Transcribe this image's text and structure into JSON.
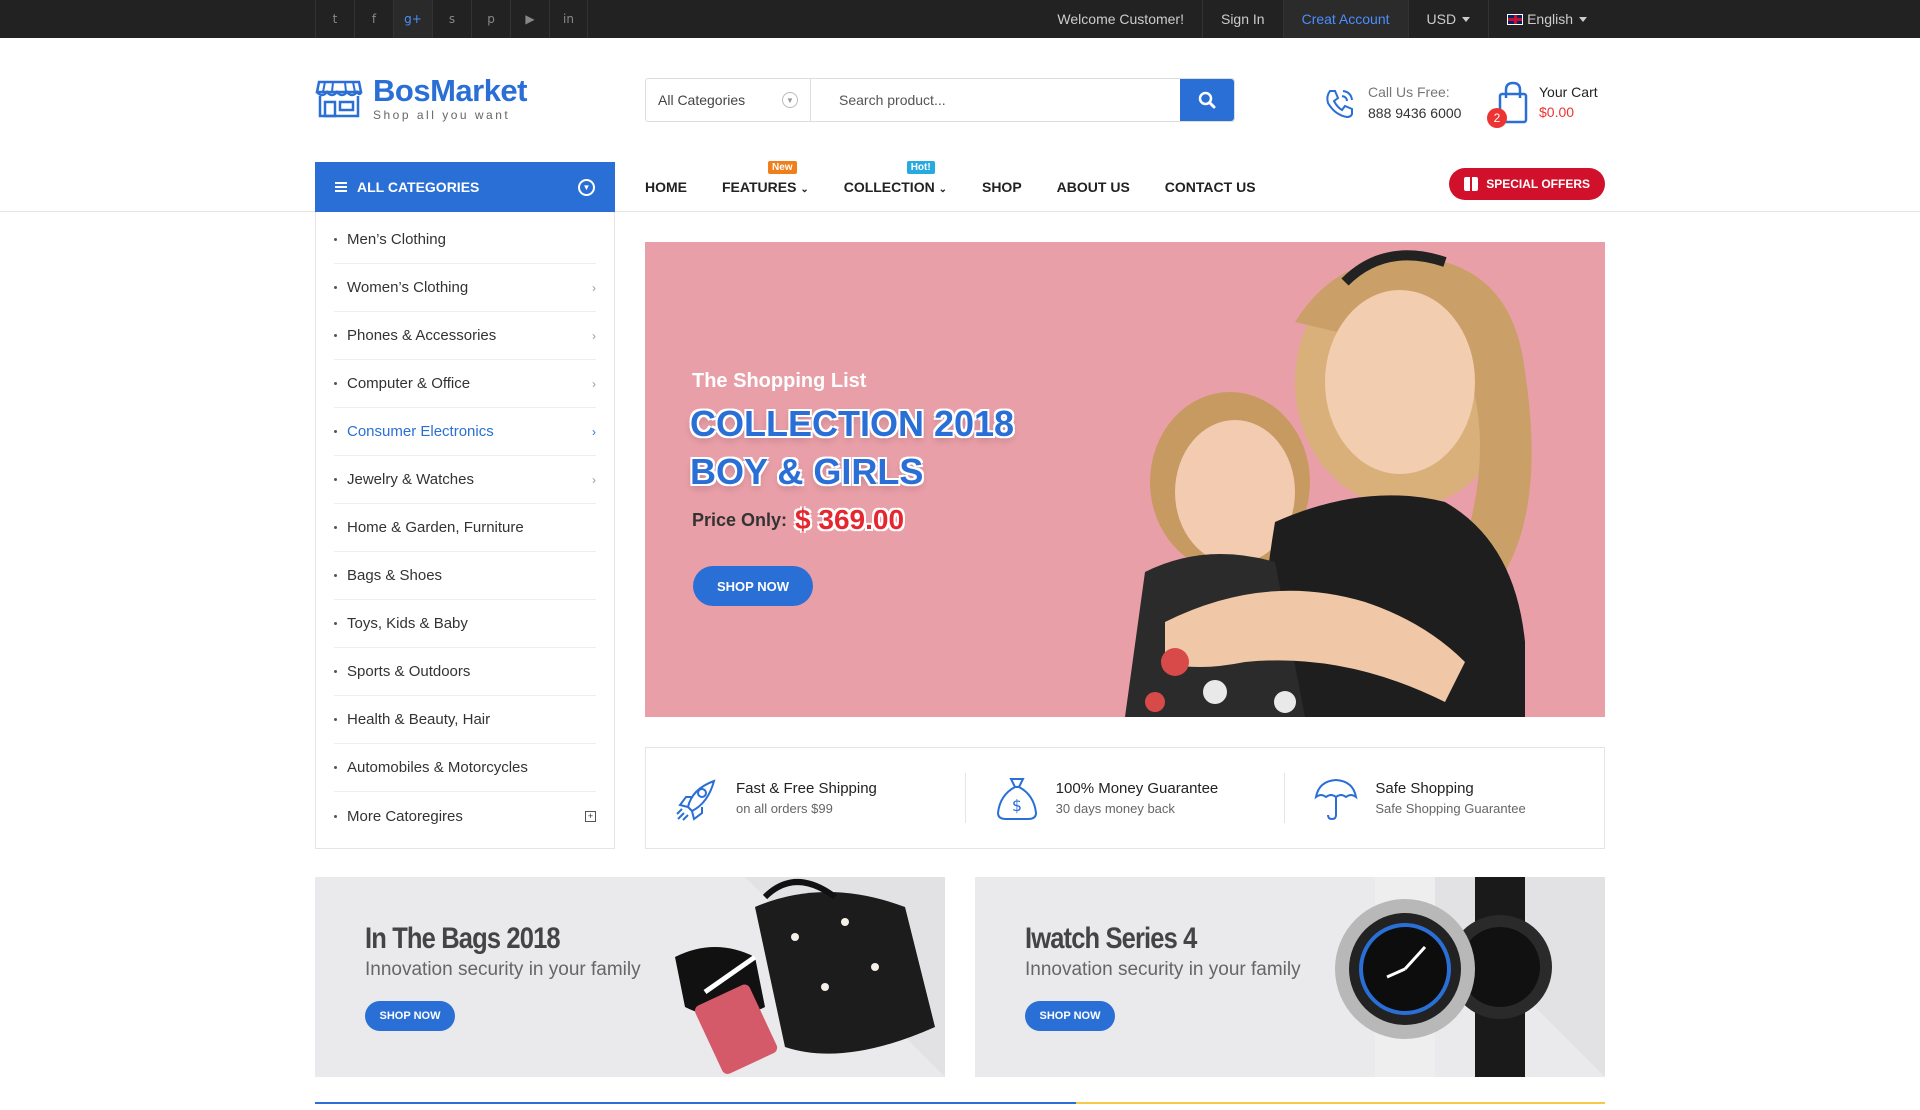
{
  "topbar": {
    "social": [
      "twitter-icon",
      "facebook-icon",
      "google-plus-icon",
      "skype-icon",
      "pinterest-icon",
      "youtube-icon",
      "linkedin-icon"
    ],
    "social_glyphs": [
      "t",
      "f",
      "g+",
      "s",
      "p",
      "▶",
      "in"
    ],
    "welcome": "Welcome Customer!",
    "sign_in": "Sign In",
    "create_account": "Creat Account",
    "currency": "USD",
    "language": "English"
  },
  "header": {
    "logo_title": "BosMarket",
    "logo_tagline": "Shop all you want",
    "search_category": "All Categories",
    "search_placeholder": "Search product...",
    "call_label": "Call Us Free:",
    "call_number": "888 9436 6000",
    "cart_title": "Your Cart",
    "cart_amount": "$0.00",
    "cart_count": "2"
  },
  "nav": {
    "all_categories": "ALL CATEGORIES",
    "items": [
      {
        "label": "HOME",
        "tag": ""
      },
      {
        "label": "FEATURES",
        "tag": "New"
      },
      {
        "label": "COLLECTION",
        "tag": "Hot!"
      },
      {
        "label": "SHOP",
        "tag": ""
      },
      {
        "label": "ABOUT US",
        "tag": ""
      },
      {
        "label": "CONTACT US",
        "tag": ""
      }
    ],
    "special_offers": "SPECIAL OFFERS"
  },
  "sidebar": {
    "items": [
      {
        "label": "Men’s Clothing",
        "arrow": false
      },
      {
        "label": "Women’s Clothing",
        "arrow": true
      },
      {
        "label": "Phones & Accessories",
        "arrow": true
      },
      {
        "label": "Computer & Office",
        "arrow": true
      },
      {
        "label": "Consumer Electronics",
        "arrow": true,
        "active": true
      },
      {
        "label": "Jewelry & Watches",
        "arrow": true
      },
      {
        "label": "Home & Garden, Furniture",
        "arrow": false
      },
      {
        "label": "Bags & Shoes",
        "arrow": false
      },
      {
        "label": "Toys, Kids & Baby",
        "arrow": false
      },
      {
        "label": "Sports & Outdoors",
        "arrow": false
      },
      {
        "label": "Health & Beauty, Hair",
        "arrow": false
      },
      {
        "label": "Automobiles & Motorcycles",
        "arrow": false
      },
      {
        "label": "More Catoregires",
        "more": true
      }
    ]
  },
  "hero": {
    "pre_title": "The Shopping List",
    "title_line1": "COLLECTION 2018",
    "title_line2": "BOY & GIRLS",
    "price_label": "Price Only:",
    "price": "$ 369.00",
    "button": "SHOP NOW"
  },
  "features": [
    {
      "title": "Fast & Free Shipping",
      "sub": "on all orders $99",
      "icon": "rocket-icon"
    },
    {
      "title": "100% Money Guarantee",
      "sub": "30 days money back",
      "icon": "money-bag-icon"
    },
    {
      "title": "Safe Shopping",
      "sub": "Safe Shopping Guarantee",
      "icon": "umbrella-icon"
    }
  ],
  "banners": [
    {
      "title": "In The Bags 2018",
      "sub": "Innovation security in your family",
      "button": "SHOP NOW"
    },
    {
      "title": "Iwatch Series 4",
      "sub": "Innovation security in your family",
      "button": "SHOP NOW"
    }
  ],
  "colors": {
    "accent": "#2a6fd6",
    "special": "#d1102c",
    "hero_bg": "#e99fa8"
  }
}
